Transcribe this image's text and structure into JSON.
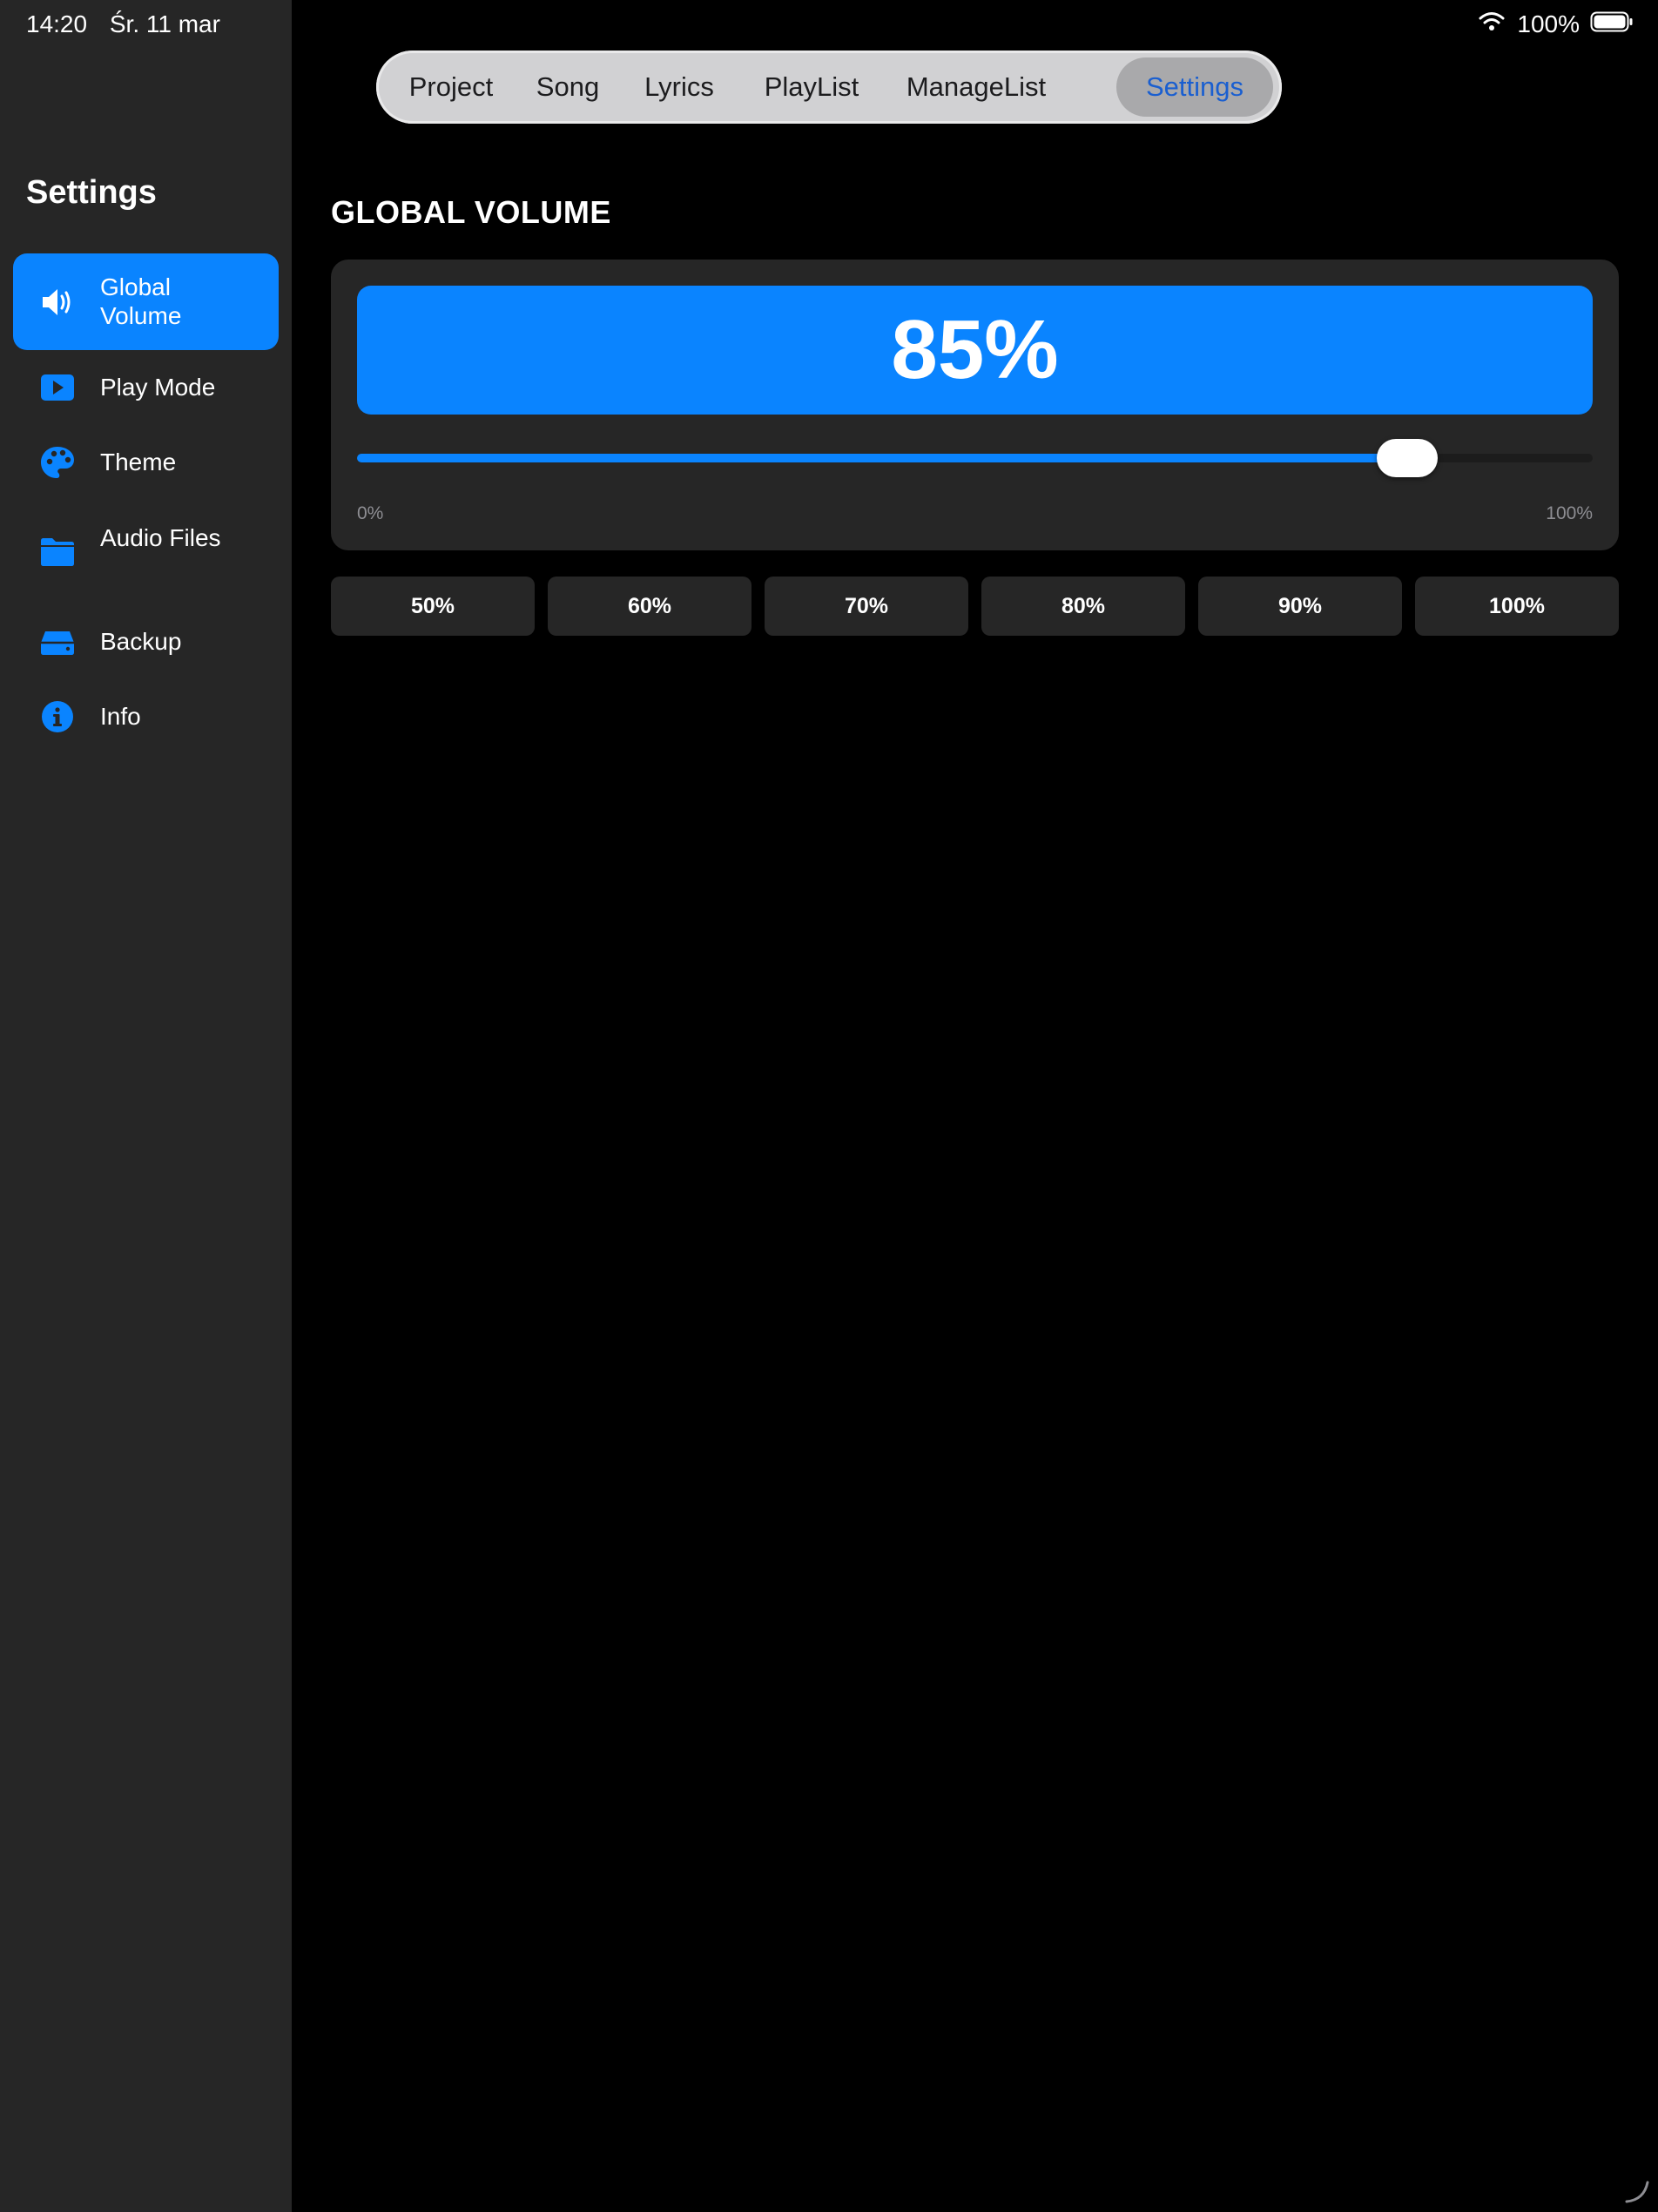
{
  "status_bar": {
    "time": "14:20",
    "date": "Śr. 11 mar",
    "battery_percent": "100%"
  },
  "sidebar": {
    "title": "Settings",
    "items": [
      {
        "label": "Global Volume",
        "icon": "speaker-icon",
        "active": true
      },
      {
        "label": "Play Mode",
        "icon": "play-icon",
        "active": false
      },
      {
        "label": "Theme",
        "icon": "palette-icon",
        "active": false
      },
      {
        "label": "Audio Files",
        "icon": "folder-icon",
        "active": false
      },
      {
        "label": "Backup",
        "icon": "drive-icon",
        "active": false
      },
      {
        "label": "Info",
        "icon": "info-icon",
        "active": false
      }
    ]
  },
  "tabs": [
    {
      "label": "Project",
      "active": false
    },
    {
      "label": "Song",
      "active": false
    },
    {
      "label": "Lyrics",
      "active": false
    },
    {
      "label": "PlayList",
      "active": false
    },
    {
      "label": "ManageList",
      "active": false
    },
    {
      "label": "Settings",
      "active": true
    }
  ],
  "main": {
    "section_title": "GLOBAL VOLUME",
    "volume_display": "85%",
    "slider": {
      "value": 85,
      "min_label": "0%",
      "max_label": "100%"
    },
    "presets": [
      "50%",
      "60%",
      "70%",
      "80%",
      "90%",
      "100%"
    ]
  },
  "colors": {
    "accent": "#0A84FF",
    "sidebar_bg": "#262626",
    "card_bg": "#262626",
    "background": "#000000",
    "tab_active_text": "#1a5fd0"
  }
}
